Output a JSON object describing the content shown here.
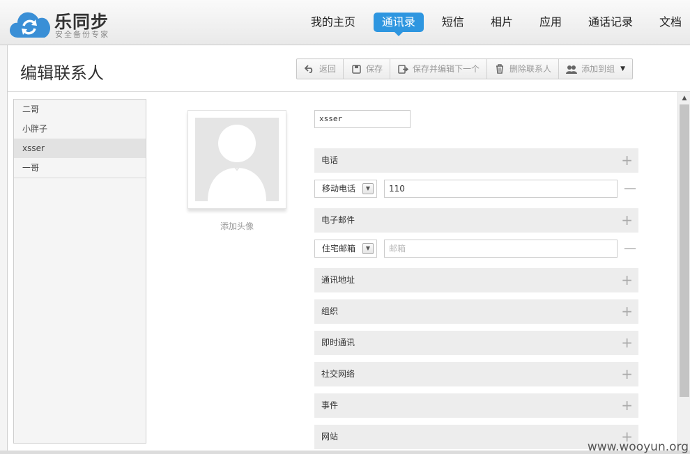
{
  "brand": {
    "name": "乐同步",
    "slogan": "安全备份专家"
  },
  "nav": [
    {
      "label": "我的主页",
      "active": false
    },
    {
      "label": "通讯录",
      "active": true
    },
    {
      "label": "短信",
      "active": false
    },
    {
      "label": "相片",
      "active": false
    },
    {
      "label": "应用",
      "active": false
    },
    {
      "label": "通话记录",
      "active": false
    },
    {
      "label": "文档",
      "active": false
    }
  ],
  "page_title": "编辑联系人",
  "toolbar": {
    "back": "返回",
    "save": "保存",
    "save_next": "保存并编辑下一个",
    "delete": "删除联系人",
    "add_to_group": "添加到组"
  },
  "contacts": [
    "二哥",
    "小胖子",
    "xsser",
    "一哥"
  ],
  "selected_contact": "xsser",
  "avatar_caption": "添加头像",
  "form": {
    "name_value": "xsser",
    "phone_section": "电话",
    "phone_type": "移动电话",
    "phone_value": "110",
    "email_section": "电子邮件",
    "email_type": "住宅邮箱",
    "email_placeholder": "邮箱",
    "sections": [
      "通讯地址",
      "组织",
      "即时通讯",
      "社交网络",
      "事件",
      "网站"
    ]
  },
  "watermark": "www.wooyun.org",
  "colors": {
    "accent": "#2e96e0",
    "logo": "#3a8fd6"
  }
}
